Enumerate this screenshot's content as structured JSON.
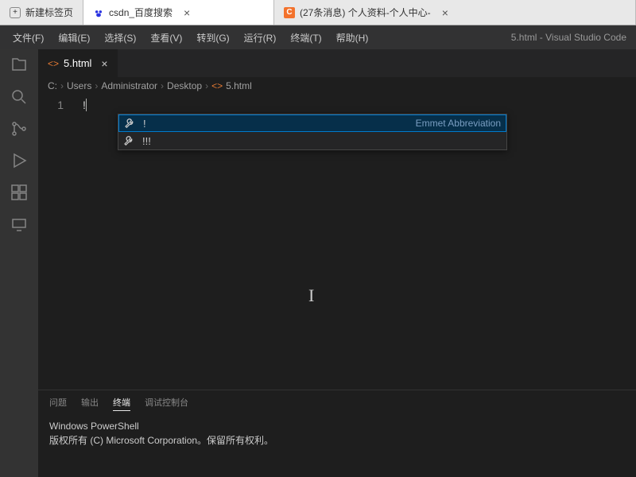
{
  "browser": {
    "tabs": [
      {
        "label": "新建标签页",
        "icon": "new-tab"
      },
      {
        "label": "csdn_百度搜索",
        "icon": "baidu",
        "closable": true
      },
      {
        "label": "(27条消息) 个人资料-个人中心-",
        "icon": "c-orange",
        "closable": true
      }
    ]
  },
  "vscode": {
    "title": "5.html - Visual Studio Code",
    "menu": [
      "文件(F)",
      "编辑(E)",
      "选择(S)",
      "查看(V)",
      "转到(G)",
      "运行(R)",
      "终端(T)",
      "帮助(H)"
    ],
    "editor_tab": {
      "filename": "5.html"
    },
    "breadcrumbs": [
      "C:",
      "Users",
      "Administrator",
      "Desktop",
      "5.html"
    ],
    "code": {
      "line_number": "1",
      "line_text": "!"
    },
    "suggest": {
      "rows": [
        {
          "label": "!",
          "detail": "Emmet Abbreviation",
          "selected": true
        },
        {
          "label": "!!!",
          "detail": "",
          "selected": false
        }
      ]
    },
    "panel": {
      "tabs": [
        "问题",
        "输出",
        "终端",
        "调试控制台"
      ],
      "active_tab_index": 2,
      "terminal_lines": [
        "Windows PowerShell",
        "版权所有 (C) Microsoft Corporation。保留所有权利。"
      ]
    }
  }
}
